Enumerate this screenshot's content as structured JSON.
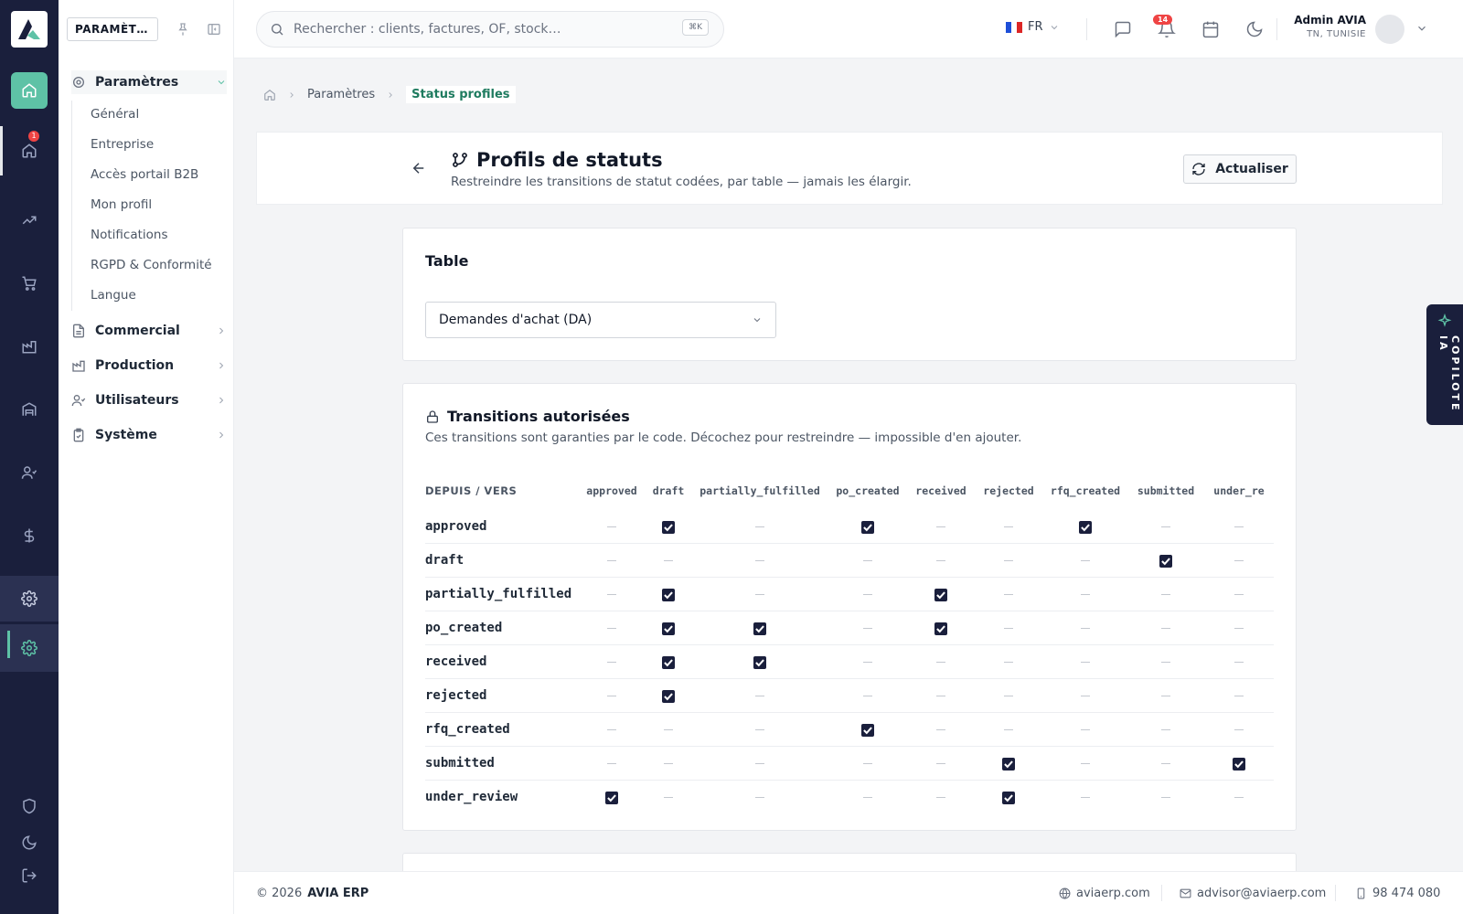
{
  "app": {
    "name": "AVIA ERP"
  },
  "sidebar": {
    "title": "PARAMÈT…",
    "groups": [
      {
        "label": "Paramètres",
        "open": true
      },
      {
        "label": "Commercial"
      },
      {
        "label": "Production"
      },
      {
        "label": "Utilisateurs"
      },
      {
        "label": "Système"
      }
    ],
    "sub_items": [
      "Général",
      "Entreprise",
      "Accès portail B2B",
      "Mon profil",
      "Notifications",
      "RGPD & Conformité",
      "Langue"
    ]
  },
  "rail": {
    "badge": "1"
  },
  "topbar": {
    "search_placeholder": "Rechercher : clients, factures, OF, stock…",
    "search_shortcut": "⌘K",
    "language": "FR",
    "notif_count": "14",
    "user_name": "Admin AVIA",
    "user_location": "TN, TUNISIE"
  },
  "breadcrumb": {
    "parent": "Paramètres",
    "current": "Status profiles"
  },
  "page": {
    "title": "Profils de statuts",
    "subtitle": "Restreindre les transitions de statut codées, par table — jamais les élargir.",
    "refresh_label": "Actualiser"
  },
  "table_card": {
    "title": "Table",
    "selected": "Demandes d'achat (DA)"
  },
  "transitions": {
    "title": "Transitions autorisées",
    "subtitle": "Ces transitions sont garanties par le code. Décochez pour restreindre — impossible d'en ajouter.",
    "corner_label": "DEPUIS / VERS",
    "columns": [
      "approved",
      "draft",
      "partially_fulfilled",
      "po_created",
      "received",
      "rejected",
      "rfq_created",
      "submitted",
      "under_re"
    ],
    "rows": [
      {
        "from": "approved",
        "allowed": [
          0,
          1,
          0,
          1,
          0,
          0,
          1,
          0,
          0
        ]
      },
      {
        "from": "draft",
        "allowed": [
          0,
          0,
          0,
          0,
          0,
          0,
          0,
          1,
          0
        ]
      },
      {
        "from": "partially_fulfilled",
        "allowed": [
          0,
          1,
          0,
          0,
          1,
          0,
          0,
          0,
          0
        ]
      },
      {
        "from": "po_created",
        "allowed": [
          0,
          1,
          1,
          0,
          1,
          0,
          0,
          0,
          0
        ]
      },
      {
        "from": "received",
        "allowed": [
          0,
          1,
          1,
          0,
          0,
          0,
          0,
          0,
          0
        ]
      },
      {
        "from": "rejected",
        "allowed": [
          0,
          1,
          0,
          0,
          0,
          0,
          0,
          0,
          0
        ]
      },
      {
        "from": "rfq_created",
        "allowed": [
          0,
          0,
          0,
          1,
          0,
          0,
          0,
          0,
          0
        ]
      },
      {
        "from": "submitted",
        "allowed": [
          0,
          0,
          0,
          0,
          0,
          1,
          0,
          0,
          1
        ]
      },
      {
        "from": "under_review",
        "allowed": [
          1,
          0,
          0,
          0,
          0,
          1,
          0,
          0,
          0
        ]
      }
    ]
  },
  "copilot": {
    "label": "COPILOTE IA"
  },
  "footer": {
    "copyright": "© 2026",
    "brand": "AVIA ERP",
    "website": "aviaerp.com",
    "email": "advisor@aviaerp.com",
    "phone": "98 474 080"
  },
  "colors": {
    "accent": "#1e7b5f",
    "accent_light": "#5ec2a6",
    "rail": "#1a1f3c",
    "danger": "#ef4444"
  }
}
